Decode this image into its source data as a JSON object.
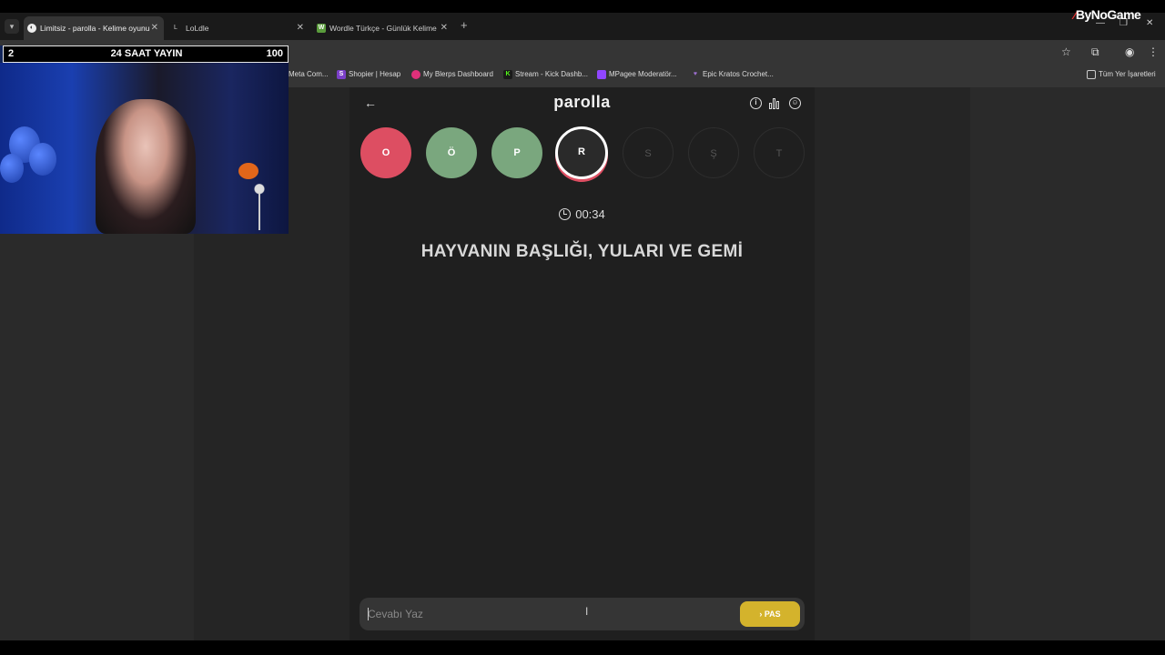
{
  "browser": {
    "tabs": [
      {
        "title": "Limitsiz - parolla - Kelime oyunu",
        "active": true
      },
      {
        "title": "LoLdle",
        "active": false
      },
      {
        "title": "Wordle Türkçe - Günlük Kelime",
        "active": false
      }
    ],
    "new_tab_label": "+",
    "tab_icon_letters": {
      "loldle": "L",
      "wordle": "W"
    },
    "bookmarks": [
      {
        "label": "Meta Com...",
        "icon": "meta-icon"
      },
      {
        "label": "Shopier | Hesap",
        "icon": "S",
        "color": "#7b3fc9"
      },
      {
        "label": "My Blerps Dashboard",
        "icon": "blerps-icon",
        "color": "#e0307a"
      },
      {
        "label": "Stream - Kick Dashb...",
        "icon": "K",
        "color": "#53fc18"
      },
      {
        "label": "MPagee Moderatör...",
        "icon": "twitch-icon",
        "color": "#9146ff"
      },
      {
        "label": "Epic Kratos Crochet...",
        "icon": "heart-icon",
        "color": "#9c6fcf"
      }
    ],
    "all_bookmarks_label": "Tüm Yer İşaretleri",
    "brand": "ByNoGame"
  },
  "stream_overlay": {
    "left_value": "2",
    "center_text": "24 SAAT YAYIN",
    "right_value": "100"
  },
  "game": {
    "title": "parolla",
    "letters": [
      {
        "char": "O",
        "state": "wrong",
        "color": "#dd4e62"
      },
      {
        "char": "Ö",
        "state": "correct",
        "color": "#7aa77e"
      },
      {
        "char": "P",
        "state": "correct",
        "color": "#7aa77e"
      },
      {
        "char": "R",
        "state": "current"
      },
      {
        "char": "S",
        "state": "pending"
      },
      {
        "char": "Ş",
        "state": "pending"
      },
      {
        "char": "T",
        "state": "pending"
      }
    ],
    "timer": "00:34",
    "question": "HAYVANIN BAŞLIĞI, YULARI VE GEMİ",
    "answer_placeholder": "Cevabı Yaz",
    "pass_label": "PAS"
  },
  "colors": {
    "accent_yellow": "#d4b32c",
    "wrong": "#dd4e62",
    "correct": "#7aa77e"
  }
}
